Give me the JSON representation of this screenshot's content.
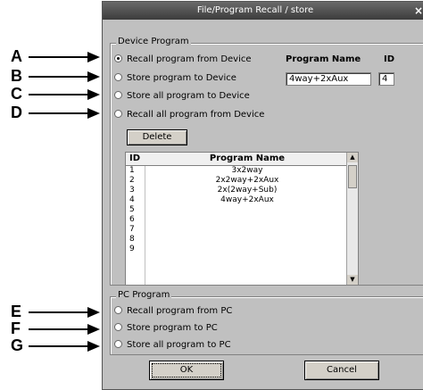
{
  "callouts": [
    "A",
    "B",
    "C",
    "D",
    "E",
    "F",
    "G"
  ],
  "dialog": {
    "title": "File/Program Recall / store",
    "close": "×"
  },
  "device_program": {
    "legend": "Device Program",
    "options": [
      {
        "label": "Recall program from Device",
        "selected": true
      },
      {
        "label": "Store program to Device",
        "selected": false
      },
      {
        "label": "Store all program to Device",
        "selected": false
      },
      {
        "label": "Recall all program from Device",
        "selected": false
      }
    ],
    "program_name_label": "Program Name",
    "id_label": "ID",
    "program_name_value": "4way+2xAux",
    "id_value": "4",
    "delete_label": "Delete",
    "table": {
      "headers": [
        "ID",
        "Program Name"
      ],
      "rows": [
        {
          "id": "1",
          "name": "3x2way"
        },
        {
          "id": "2",
          "name": "2x2way+2xAux"
        },
        {
          "id": "3",
          "name": "2x(2way+Sub)"
        },
        {
          "id": "4",
          "name": "4way+2xAux"
        },
        {
          "id": "5",
          "name": ""
        },
        {
          "id": "6",
          "name": ""
        },
        {
          "id": "7",
          "name": ""
        },
        {
          "id": "8",
          "name": ""
        },
        {
          "id": "9",
          "name": ""
        }
      ]
    }
  },
  "pc_program": {
    "legend": "PC Program",
    "options": [
      {
        "label": "Recall program from PC",
        "selected": false
      },
      {
        "label": "Store program to PC",
        "selected": false
      },
      {
        "label": "Store all program to PC",
        "selected": false
      }
    ]
  },
  "buttons": {
    "ok": "OK",
    "cancel": "Cancel"
  }
}
